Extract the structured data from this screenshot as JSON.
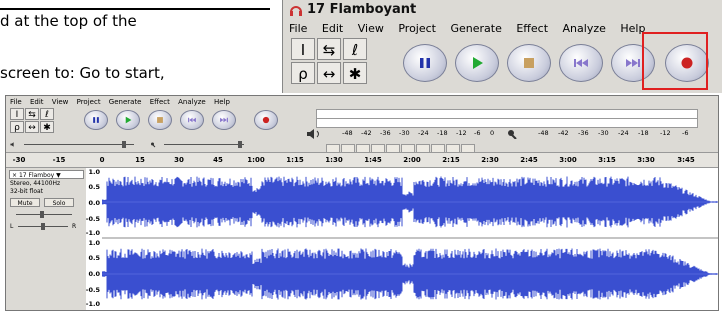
{
  "document": {
    "line1": "d at the top of the",
    "line2": "screen to: Go to start,"
  },
  "zoom": {
    "title": "17 Flamboyant",
    "menu": [
      "File",
      "Edit",
      "View",
      "Project",
      "Generate",
      "Effect",
      "Analyze",
      "Help"
    ],
    "tools": [
      "I",
      "⇆",
      "ℓ",
      "ρ",
      "↔",
      "✱"
    ],
    "buttons": [
      "pause",
      "play",
      "stop",
      "skip-start",
      "skip-end",
      "record"
    ],
    "highlight_color": "#e02020"
  },
  "main": {
    "menu": [
      "File",
      "Edit",
      "View",
      "Project",
      "Generate",
      "Effect",
      "Analyze",
      "Help"
    ],
    "meter_ticks": [
      "-48",
      "-42",
      "-36",
      "-30",
      "-24",
      "-18",
      "-12",
      "-6",
      "0"
    ],
    "meter_ticks_right": [
      "-48",
      "-42",
      "-36",
      "-30",
      "-24",
      "-18",
      "-12",
      "-6"
    ],
    "ruler": [
      "-30",
      "-15",
      "0",
      "15",
      "30",
      "45",
      "1:00",
      "1:15",
      "1:30",
      "1:45",
      "2:00",
      "2:15",
      "2:30",
      "2:45",
      "3:00",
      "3:15",
      "3:30",
      "3:45"
    ],
    "track": {
      "name": "17 Flamboy",
      "format": "Stereo, 44100Hz",
      "bits": "32-bit float",
      "mute": "Mute",
      "solo": "Solo",
      "left": "L",
      "right": "R"
    },
    "scale": [
      "1.0",
      "0.5",
      "0.0",
      "-0.5",
      "-1.0",
      "1.0",
      "0.5",
      "0.0",
      "-0.5",
      "-1.0"
    ],
    "wave_color": "#3a4fd0"
  }
}
